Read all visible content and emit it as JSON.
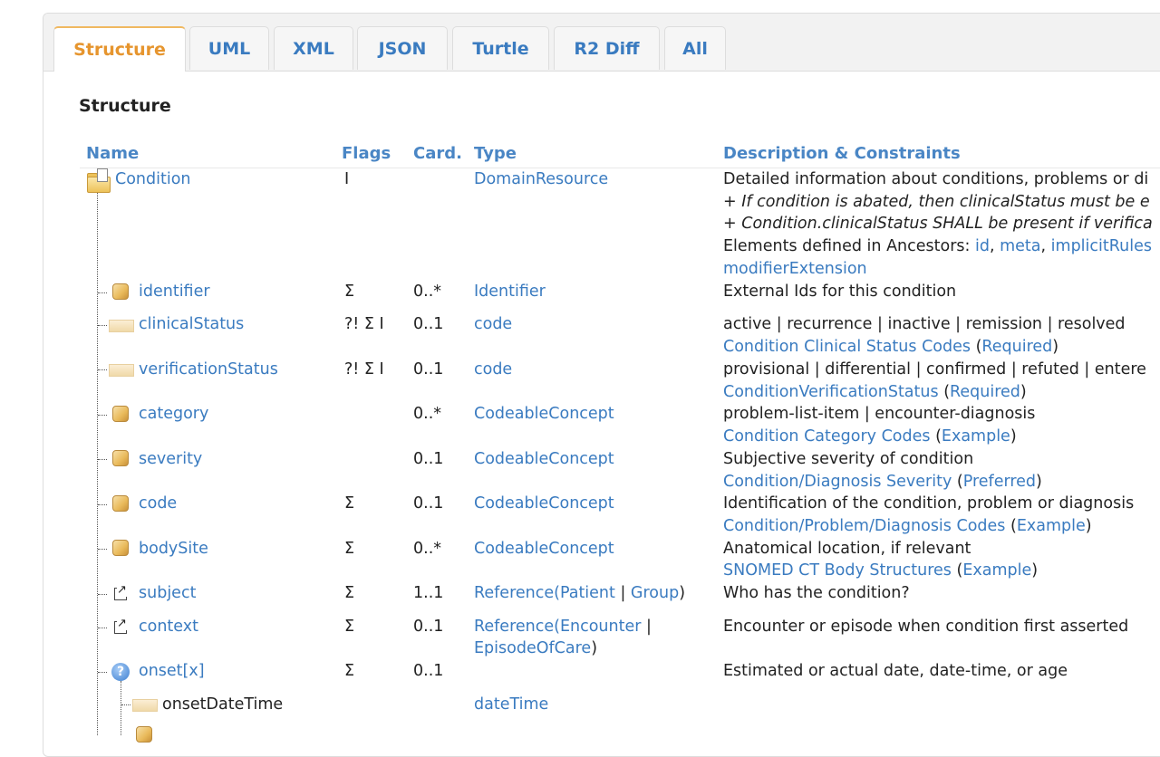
{
  "tabs": [
    {
      "label": "Structure",
      "active": true
    },
    {
      "label": "UML"
    },
    {
      "label": "XML"
    },
    {
      "label": "JSON"
    },
    {
      "label": "Turtle"
    },
    {
      "label": "R2 Diff"
    },
    {
      "label": "All"
    }
  ],
  "section_title": "Structure",
  "columns": {
    "name": "Name",
    "flags": "Flags",
    "card": "Card.",
    "type": "Type",
    "desc": "Description & Constraints"
  },
  "root": {
    "name": "Condition",
    "flags": "I",
    "type": "DomainResource",
    "desc_line1": "Detailed information about conditions, problems or di",
    "desc_line2": "+ If condition is abated, then clinicalStatus must be e",
    "desc_line3": "+ Condition.clinicalStatus SHALL be present if verifica",
    "ancestors_prefix": "Elements defined in Ancestors: ",
    "ancestors_links": [
      "id",
      "meta",
      "implicitRules"
    ],
    "ancestors_sep": ", ",
    "ancestors_last": "modifierExtension"
  },
  "rows": [
    {
      "name": "identifier",
      "icon": "cube-icon",
      "flags": "Σ",
      "card": "0..*",
      "type": "Identifier",
      "desc": "External Ids for this condition"
    },
    {
      "name": "clinicalStatus",
      "icon": "primitive-icon",
      "flags": "?! Σ I",
      "card": "0..1",
      "type": "code",
      "desc": "active | recurrence | inactive | remission | resolved",
      "binding": "Condition Clinical Status Codes",
      "strength": "Required"
    },
    {
      "name": "verificationStatus",
      "icon": "primitive-icon",
      "flags": "?! Σ I",
      "card": "0..1",
      "type": "code",
      "desc": "provisional | differential | confirmed | refuted | entere",
      "binding": "ConditionVerificationStatus",
      "strength": "Required"
    },
    {
      "name": "category",
      "icon": "cube-icon",
      "flags": "",
      "card": "0..*",
      "type": "CodeableConcept",
      "desc": "problem-list-item | encounter-diagnosis",
      "binding": "Condition Category Codes",
      "strength": "Example"
    },
    {
      "name": "severity",
      "icon": "cube-icon",
      "flags": "",
      "card": "0..1",
      "type": "CodeableConcept",
      "desc": "Subjective severity of condition",
      "binding": "Condition/Diagnosis Severity",
      "strength": "Preferred"
    },
    {
      "name": "code",
      "icon": "cube-icon",
      "flags": "Σ",
      "card": "0..1",
      "type": "CodeableConcept",
      "desc": "Identification of the condition, problem or diagnosis",
      "binding": "Condition/Problem/Diagnosis Codes",
      "strength": "Example"
    },
    {
      "name": "bodySite",
      "icon": "cube-icon",
      "flags": "Σ",
      "card": "0..*",
      "type": "CodeableConcept",
      "desc": "Anatomical location, if relevant",
      "binding": "SNOMED CT Body Structures",
      "strength": "Example"
    },
    {
      "name": "subject",
      "icon": "reference-icon",
      "flags": "Σ",
      "card": "1..1",
      "type_prefix": "Reference(",
      "type_targets": [
        "Patient",
        "Group"
      ],
      "type_suffix": ")",
      "desc": "Who has the condition?"
    },
    {
      "name": "context",
      "icon": "reference-icon",
      "flags": "Σ",
      "card": "0..1",
      "type_prefix": "Reference(",
      "type_targets": [
        "Encounter",
        "EpisodeOfCare"
      ],
      "type_suffix": ")",
      "desc": "Encounter or episode when condition first asserted"
    },
    {
      "name": "onset[x]",
      "icon": "choice-icon",
      "flags": "Σ",
      "card": "0..1",
      "type": "",
      "desc": "Estimated or actual date, date-time, or age"
    },
    {
      "name": "onsetDateTime",
      "icon": "primitive-icon",
      "flags": "",
      "card": "",
      "type": "dateTime",
      "desc": ""
    }
  ],
  "punct": {
    "open": "(",
    "close": ")",
    "pipe": " | ",
    "pipe_trail": " |"
  }
}
